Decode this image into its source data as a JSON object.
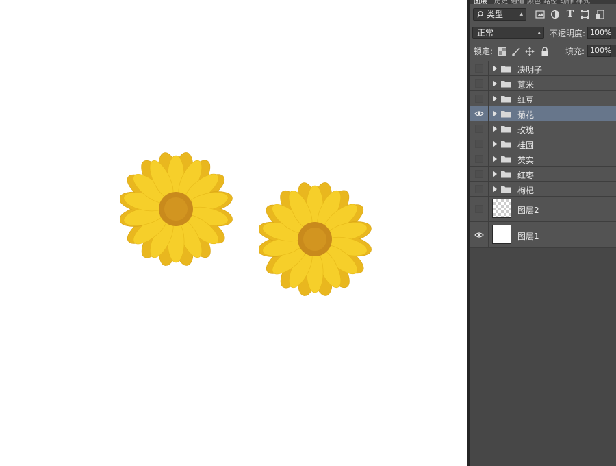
{
  "colors": {
    "panel_bg": "#535353",
    "selected_row": "#67768b",
    "petal": "#f6cf2a",
    "center": "#c98a1c"
  },
  "panel": {
    "tabs": [
      "图层",
      "历史",
      "通道",
      "颜色",
      "路径",
      "动作",
      "样式"
    ],
    "filter": {
      "label": "类型",
      "icons": [
        "image-filter-icon",
        "adjustment-filter-icon",
        "type-filter-icon",
        "shape-filter-icon",
        "smart-object-filter-icon"
      ],
      "type_glyph": "T"
    },
    "blend_mode": "正常",
    "opacity_label": "不透明度:",
    "opacity_value": "100%",
    "lock_label": "锁定:",
    "fill_label": "填充:",
    "fill_value": "100%"
  },
  "layers": [
    {
      "name": "决明子",
      "type": "group",
      "visible": false,
      "selected": false
    },
    {
      "name": "薏米",
      "type": "group",
      "visible": false,
      "selected": false
    },
    {
      "name": "红豆",
      "type": "group",
      "visible": false,
      "selected": false
    },
    {
      "name": "菊花",
      "type": "group",
      "visible": true,
      "selected": true
    },
    {
      "name": "玫瑰",
      "type": "group",
      "visible": false,
      "selected": false
    },
    {
      "name": "桂圆",
      "type": "group",
      "visible": false,
      "selected": false
    },
    {
      "name": "芡实",
      "type": "group",
      "visible": false,
      "selected": false
    },
    {
      "name": "红枣",
      "type": "group",
      "visible": false,
      "selected": false
    },
    {
      "name": "枸杞",
      "type": "group",
      "visible": false,
      "selected": false
    },
    {
      "name": "图层2",
      "type": "pixel",
      "thumbnail": "transparent",
      "visible": false,
      "selected": false
    },
    {
      "name": "图层1",
      "type": "pixel",
      "thumbnail": "white",
      "visible": true,
      "selected": false
    }
  ]
}
